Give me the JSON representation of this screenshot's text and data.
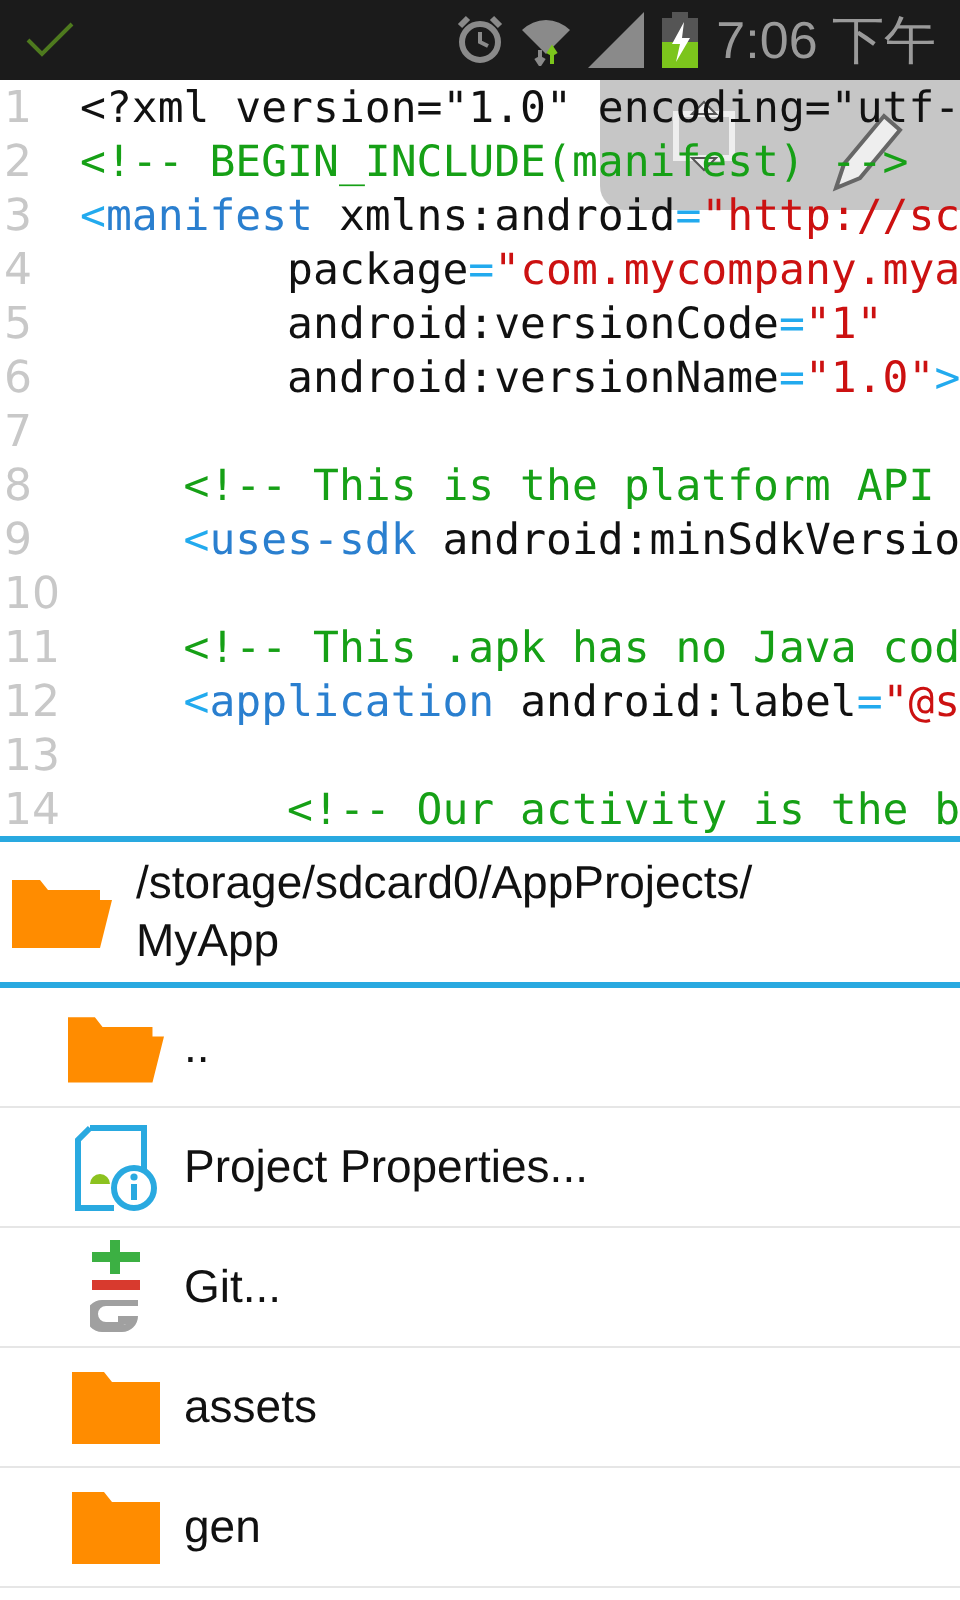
{
  "status_bar": {
    "time": "7:06 下午",
    "battery_charging": true
  },
  "editor": {
    "lines": [
      {
        "number": "1",
        "tokens": [
          {
            "kind": "plain",
            "text": "<?xml version=\"1.0\" encoding=\"utf-"
          }
        ]
      },
      {
        "number": "2",
        "tokens": [
          {
            "kind": "comment",
            "text": "<!-- BEGIN_INCLUDE(manifest) -->"
          }
        ]
      },
      {
        "number": "3",
        "tokens": [
          {
            "kind": "punct",
            "text": "<"
          },
          {
            "kind": "tag",
            "text": "manifest"
          },
          {
            "kind": "plain",
            "text": " xmlns:android"
          },
          {
            "kind": "punct",
            "text": "="
          },
          {
            "kind": "string",
            "text": "\"http://sc"
          }
        ]
      },
      {
        "number": "4",
        "tokens": [
          {
            "kind": "plain",
            "text": "        package"
          },
          {
            "kind": "punct",
            "text": "="
          },
          {
            "kind": "string",
            "text": "\"com.mycompany.mya"
          }
        ]
      },
      {
        "number": "5",
        "tokens": [
          {
            "kind": "plain",
            "text": "        android:versionCode"
          },
          {
            "kind": "punct",
            "text": "="
          },
          {
            "kind": "string",
            "text": "\"1\""
          }
        ]
      },
      {
        "number": "6",
        "tokens": [
          {
            "kind": "plain",
            "text": "        android:versionName"
          },
          {
            "kind": "punct",
            "text": "="
          },
          {
            "kind": "string",
            "text": "\"1.0\""
          },
          {
            "kind": "punct",
            "text": ">"
          }
        ]
      },
      {
        "number": "7"
      },
      {
        "number": "8",
        "tokens": [
          {
            "kind": "comment",
            "text": "    <!-- This is the platform API"
          }
        ]
      },
      {
        "number": "9",
        "tokens": [
          {
            "kind": "punct",
            "text": "    <"
          },
          {
            "kind": "tag",
            "text": "uses-sdk"
          },
          {
            "kind": "plain",
            "text": " android:minSdkVersio"
          }
        ]
      },
      {
        "number": "10"
      },
      {
        "number": "11",
        "tokens": [
          {
            "kind": "comment",
            "text": "    <!-- This .apk has no Java cod"
          }
        ]
      },
      {
        "number": "12",
        "tokens": [
          {
            "kind": "punct",
            "text": "    <"
          },
          {
            "kind": "tag",
            "text": "application"
          },
          {
            "kind": "plain",
            "text": " android:label"
          },
          {
            "kind": "punct",
            "text": "="
          },
          {
            "kind": "string",
            "text": "\"@s"
          }
        ]
      },
      {
        "number": "13"
      },
      {
        "number": "14",
        "tokens": [
          {
            "kind": "comment",
            "text": "        <!-- Our activity is the b"
          }
        ]
      }
    ]
  },
  "browser": {
    "path": "/storage/sdcard0/AppProjects/MyApp",
    "items": [
      {
        "kind": "parent",
        "label": ".."
      },
      {
        "kind": "properties",
        "label": "Project Properties..."
      },
      {
        "kind": "git",
        "label": "Git..."
      },
      {
        "kind": "folder",
        "label": "assets"
      },
      {
        "kind": "folder",
        "label": "gen"
      }
    ]
  }
}
